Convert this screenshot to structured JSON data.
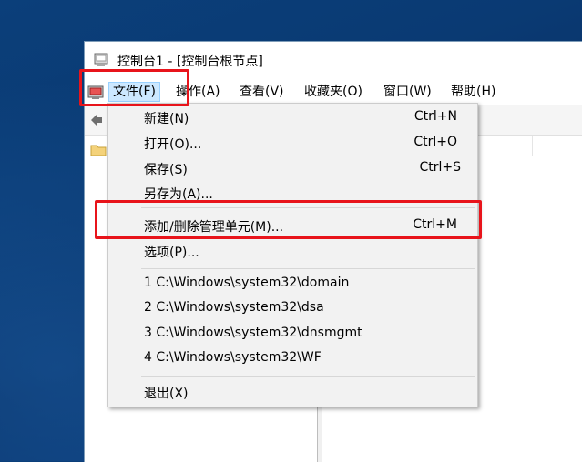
{
  "window": {
    "title": "控制台1 - [控制台根节点]",
    "icon": "mmc-console-icon"
  },
  "menubar": {
    "icon": "console-menu-icon",
    "items": [
      {
        "label": "文件(F)",
        "active": true
      },
      {
        "label": "操作(A)"
      },
      {
        "label": "查看(V)"
      },
      {
        "label": "收藏夹(O)"
      },
      {
        "label": "窗口(W)"
      },
      {
        "label": "帮助(H)"
      }
    ]
  },
  "file_menu": {
    "items": [
      {
        "label": "新建(N)",
        "shortcut": "Ctrl+N"
      },
      {
        "label": "打开(O)...",
        "shortcut": "Ctrl+O"
      },
      {
        "label": "保存(S)",
        "shortcut": "Ctrl+S"
      },
      {
        "label": "另存为(A)..."
      },
      {
        "label": "添加/删除管理单元(M)...",
        "shortcut": "Ctrl+M",
        "highlighted": true
      },
      {
        "label": "选项(P)..."
      },
      {
        "label": "1 C:\\Windows\\system32\\domain"
      },
      {
        "label": "2 C:\\Windows\\system32\\dsa"
      },
      {
        "label": "3 C:\\Windows\\system32\\dnsmgmt"
      },
      {
        "label": "4 C:\\Windows\\system32\\WF"
      },
      {
        "label": "退出(X)"
      }
    ]
  },
  "colors": {
    "annotation_red": "#e8141b",
    "menu_active_bg": "#cce8ff",
    "menu_bg": "#f2f2f2"
  }
}
